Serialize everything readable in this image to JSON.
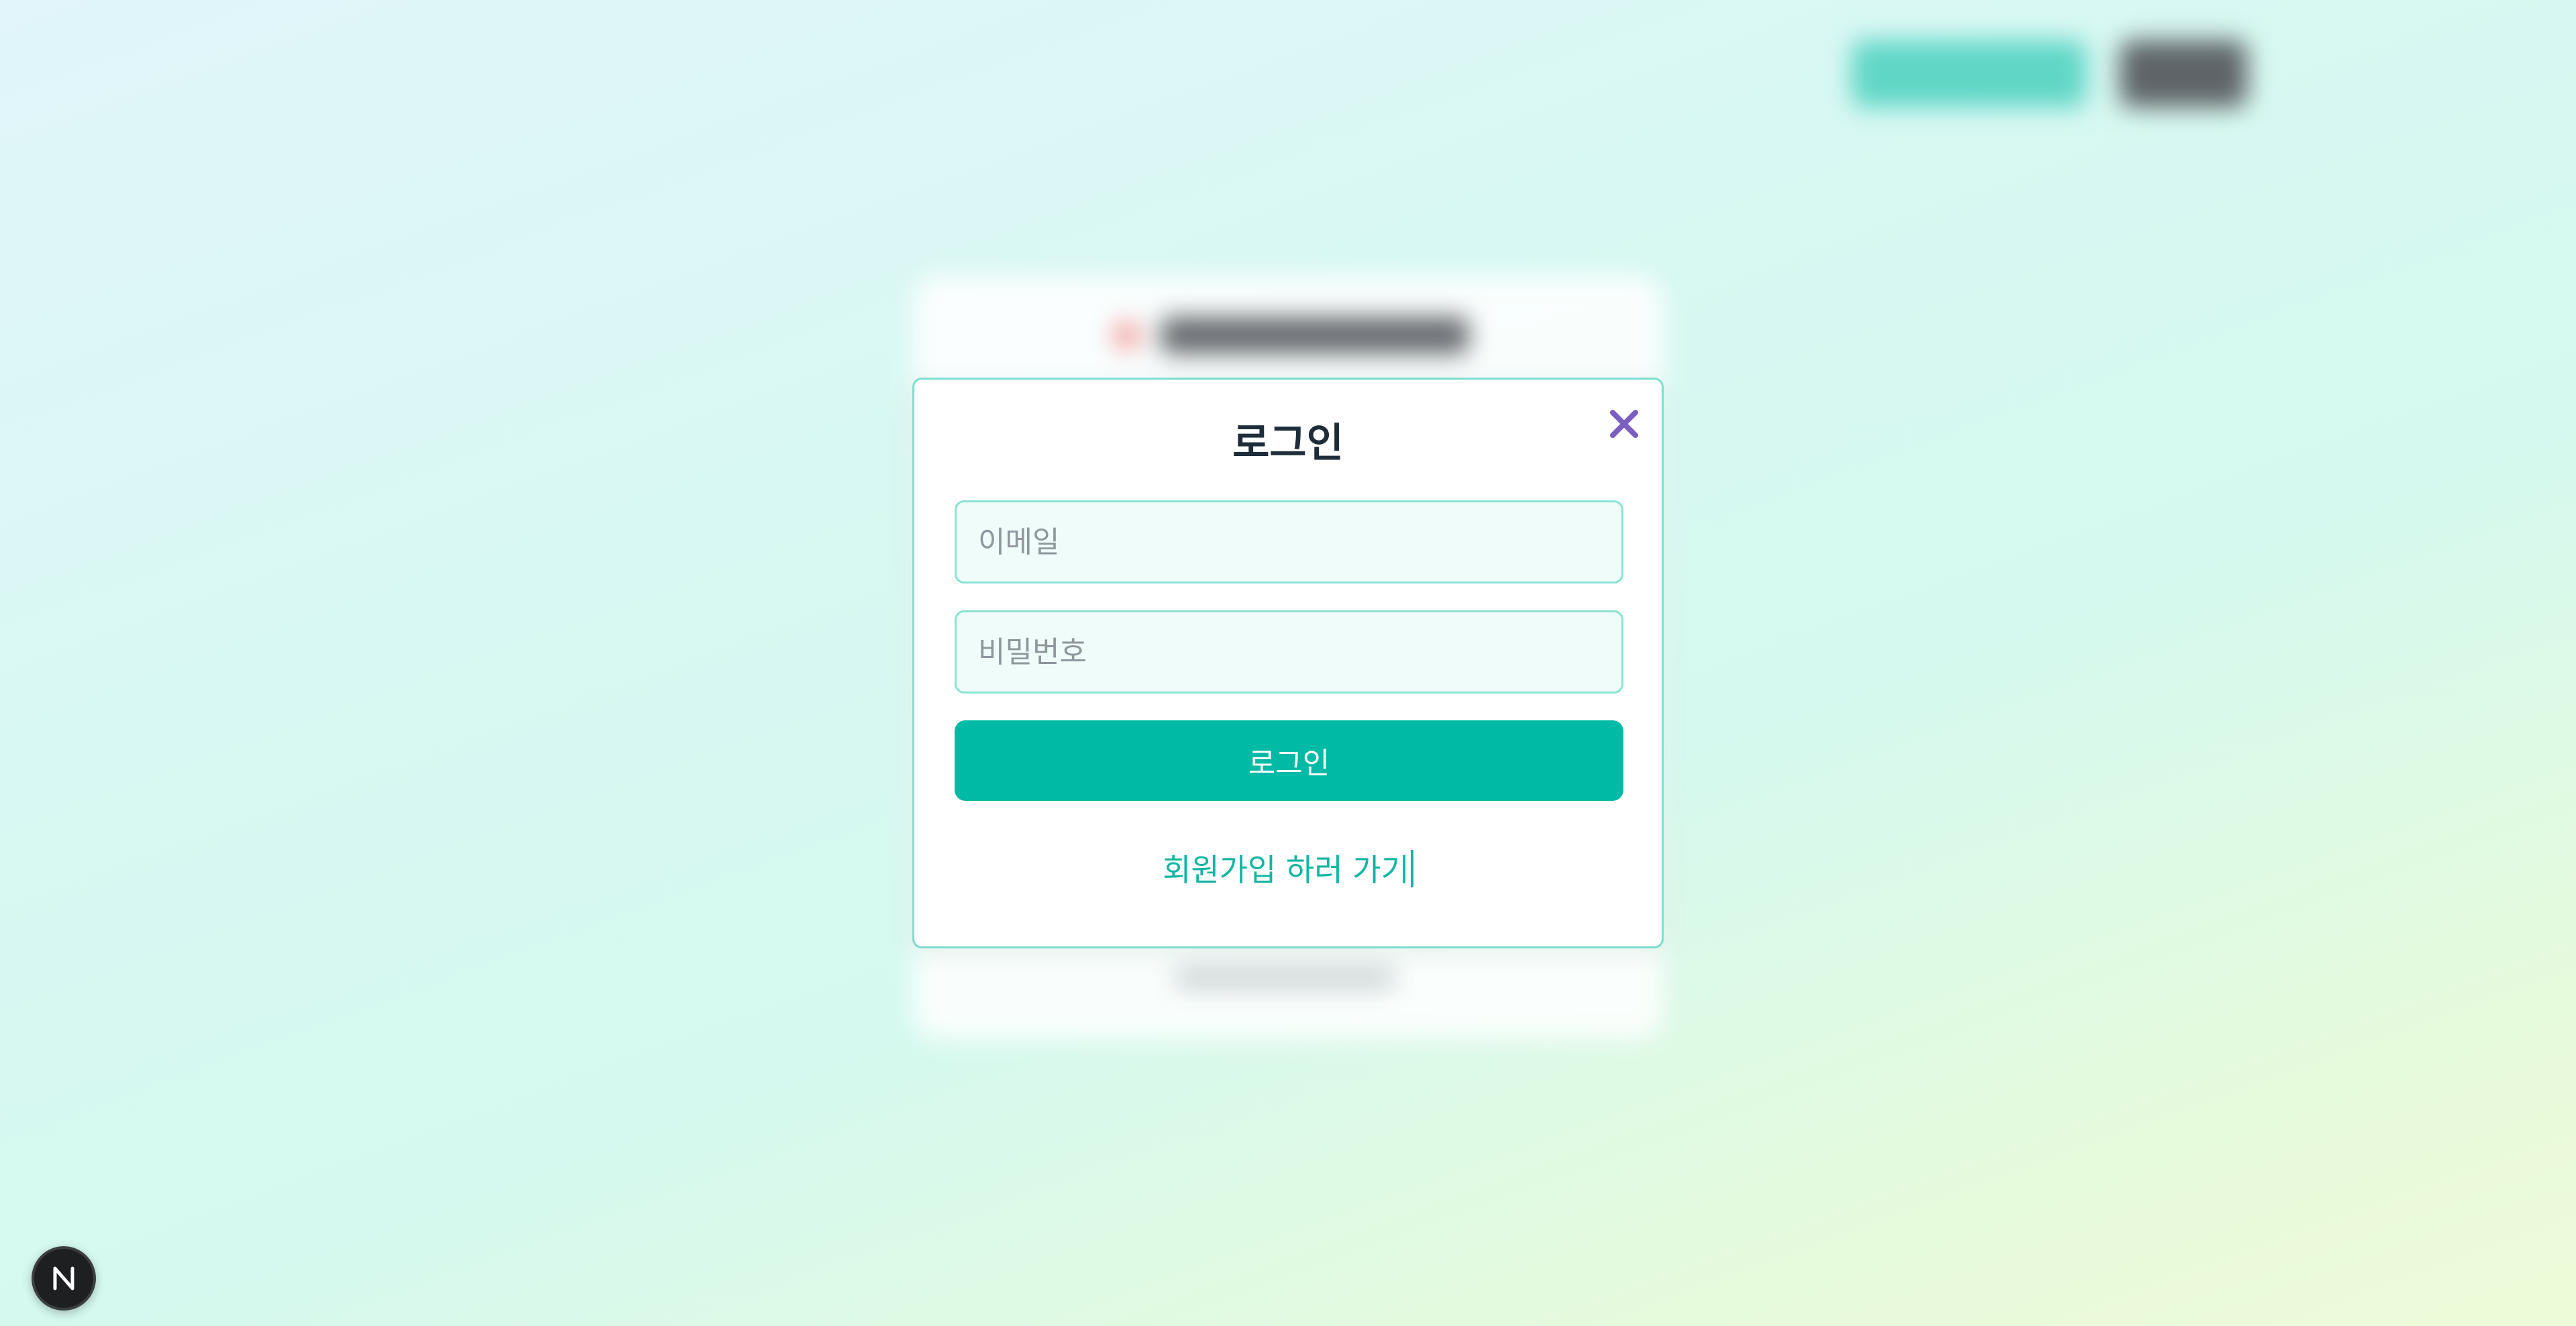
{
  "colors": {
    "accent": "#00baa5",
    "link": "#10b5a2",
    "input_border": "#8ae3d4",
    "input_bg": "#effcf9",
    "close_icon": "#7a5ec2",
    "title_text": "#1f2d3a"
  },
  "background": {
    "top_buttons": [
      "blurred-primary-button",
      "blurred-secondary-button"
    ]
  },
  "modal": {
    "title": "로그인",
    "close_icon": "close-icon",
    "email": {
      "placeholder": "이메일",
      "value": ""
    },
    "password": {
      "placeholder": "비밀번호",
      "value": ""
    },
    "submit_label": "로그인",
    "signup_link": "회원가입 하러 가기"
  },
  "badge": {
    "icon": "next-logo-icon",
    "letter": "N"
  }
}
